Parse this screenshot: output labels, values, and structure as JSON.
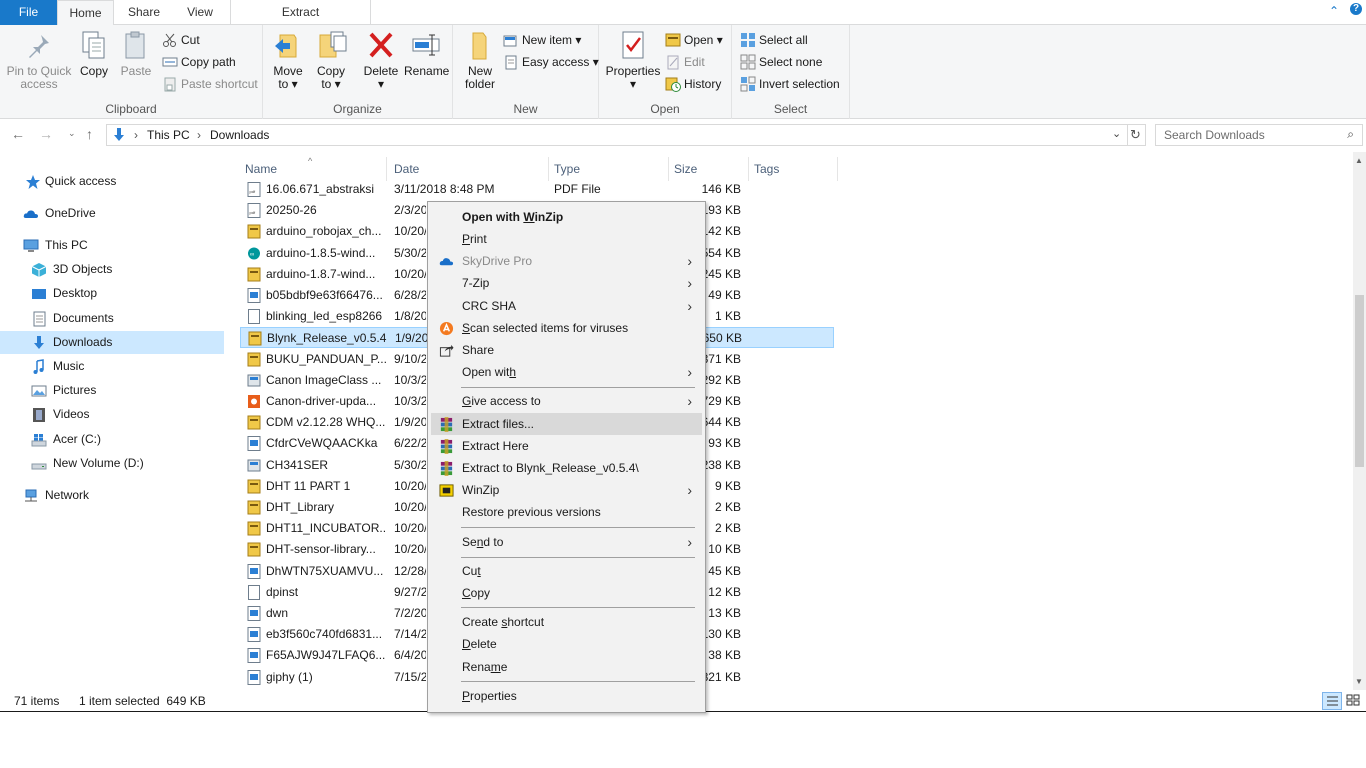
{
  "ribbon_tabs": {
    "file": "File",
    "home": "Home",
    "share": "Share",
    "view": "View",
    "extract": "Extract"
  },
  "window": {
    "minimize_glyph": "⌃",
    "help_glyph": "?"
  },
  "clipboard": {
    "pin": "Pin to Quick",
    "pin2": "access",
    "copy": "Copy",
    "paste": "Paste",
    "cut": "Cut",
    "copy_path": "Copy path",
    "paste_shortcut": "Paste shortcut",
    "label": "Clipboard"
  },
  "organize": {
    "move": "Move",
    "move2": "to ▾",
    "copy": "Copy",
    "copy2": "to ▾",
    "delete": "Delete",
    "delete2": "▾",
    "rename": "Rename",
    "label": "Organize"
  },
  "new_group": {
    "new_folder": "New",
    "new_folder2": "folder",
    "new_item": "New item ▾",
    "easy_access": "Easy access ▾",
    "label": "New"
  },
  "open_group": {
    "properties": "Properties",
    "properties2": "▾",
    "open": "Open ▾",
    "edit": "Edit",
    "history": "History",
    "label": "Open"
  },
  "select_group": {
    "select_all": "Select all",
    "select_none": "Select none",
    "invert": "Invert selection",
    "label": "Select"
  },
  "address": {
    "this_pc": "This PC",
    "downloads": "Downloads",
    "separator": "›",
    "search_placeholder": "Search Downloads"
  },
  "nav": {
    "quick_access": "Quick access",
    "onedrive": "OneDrive",
    "this_pc": "This PC",
    "objects3d": "3D Objects",
    "desktop": "Desktop",
    "documents": "Documents",
    "downloads": "Downloads",
    "music": "Music",
    "pictures": "Pictures",
    "videos": "Videos",
    "acer": "Acer (C:)",
    "newvol": "New Volume (D:)",
    "network": "Network"
  },
  "columns": {
    "name": "Name",
    "date": "Date",
    "type": "Type",
    "size": "Size",
    "tags": "Tags"
  },
  "files": [
    {
      "name": "16.06.671_abstraksi",
      "date": "3/11/2018 8:48 PM",
      "type": "PDF File",
      "size": "146 KB"
    },
    {
      "name": "20250-26",
      "date": "2/3/20",
      "type": "",
      "size": "193 KB"
    },
    {
      "name": "arduino_robojax_ch...",
      "date": "10/20/",
      "type": "",
      "size": "142 KB"
    },
    {
      "name": "arduino-1.8.5-wind...",
      "date": "5/30/2",
      "type": "",
      "size": "554 KB"
    },
    {
      "name": "arduino-1.8.7-wind...",
      "date": "10/20/",
      "type": "",
      "size": "245 KB"
    },
    {
      "name": "b05bdbf9e63f66476...",
      "date": "6/28/2",
      "type": "",
      "size": "49 KB"
    },
    {
      "name": "blinking_led_esp8266",
      "date": "1/8/20",
      "type": "",
      "size": "1 KB"
    },
    {
      "name": "Blynk_Release_v0.5.4",
      "date": "1/9/20",
      "type": "",
      "size": "650 KB"
    },
    {
      "name": "BUKU_PANDUAN_P...",
      "date": "9/10/2",
      "type": "",
      "size": "371 KB"
    },
    {
      "name": "Canon ImageClass ...",
      "date": "10/3/2",
      "type": "",
      "size": "292 KB"
    },
    {
      "name": "Canon-driver-upda...",
      "date": "10/3/2",
      "type": "",
      "size": "729 KB"
    },
    {
      "name": "CDM v2.12.28 WHQ...",
      "date": "1/9/20",
      "type": "",
      "size": "644 KB"
    },
    {
      "name": "CfdrCVeWQAACKka",
      "date": "6/22/2",
      "type": "",
      "size": "93 KB"
    },
    {
      "name": "CH341SER",
      "date": "5/30/2",
      "type": "",
      "size": "238 KB"
    },
    {
      "name": "DHT 11 PART 1",
      "date": "10/20/",
      "type": "",
      "size": "9 KB"
    },
    {
      "name": "DHT_Library",
      "date": "10/20/",
      "type": "",
      "size": "2 KB"
    },
    {
      "name": "DHT11_INCUBATOR...",
      "date": "10/20/",
      "type": "",
      "size": "2 KB"
    },
    {
      "name": "DHT-sensor-library...",
      "date": "10/20/",
      "type": "",
      "size": "10 KB"
    },
    {
      "name": "DhWTN75XUAMVU...",
      "date": "12/28/",
      "type": "",
      "size": "45 KB"
    },
    {
      "name": "dpinst",
      "date": "9/27/2",
      "type": "",
      "size": "12 KB"
    },
    {
      "name": "dwn",
      "date": "7/2/20",
      "type": "",
      "size": "13 KB"
    },
    {
      "name": "eb3f560c740fd6831...",
      "date": "7/14/2",
      "type": "",
      "size": "130 KB"
    },
    {
      "name": "F65AJW9J47LFAQ6....",
      "date": "6/4/20",
      "type": "",
      "size": "38 KB"
    },
    {
      "name": "giphy (1)",
      "date": "7/15/2",
      "type": "",
      "size": "821 KB"
    }
  ],
  "status": {
    "items": "71 items",
    "selected": "1 item selected  649 KB"
  },
  "context_menu": {
    "open_winzip_a": "Open with ",
    "open_winzip_b": "W",
    "open_winzip_c": "inZip",
    "print_a": "P",
    "print_b": "rint",
    "skydrive": "SkyDrive Pro",
    "zip7": "7-Zip",
    "crc": "CRC SHA",
    "scan_a": "S",
    "scan_b": "can selected items for viruses",
    "share": "Share",
    "open_with_a": "Open wit",
    "open_with_b": "h",
    "give_access_a": "G",
    "give_access_b": "ive access to",
    "extract_files_a": "Extract files...",
    "extract_here_a": "Extract Here",
    "extract_to_a": "Extract to Blynk_Release_v0.5.4\\",
    "winzip": "WinZip",
    "restore": "Restore previous versions",
    "send_to_a": "Se",
    "send_to_b": "n",
    "send_to_c": "d to",
    "cut_a": "Cu",
    "cut_b": "t",
    "copy_a": "C",
    "copy_b": "opy",
    "create_shortcut_a": "Create ",
    "create_shortcut_b": "s",
    "create_shortcut_c": "hortcut",
    "delete_a": "D",
    "delete_b": "elete",
    "rename_a": "Rena",
    "rename_b": "m",
    "rename_c": "e",
    "properties_a": "P",
    "properties_b": "r",
    "properties_c": "operties",
    "submenu_arrow": "›"
  }
}
